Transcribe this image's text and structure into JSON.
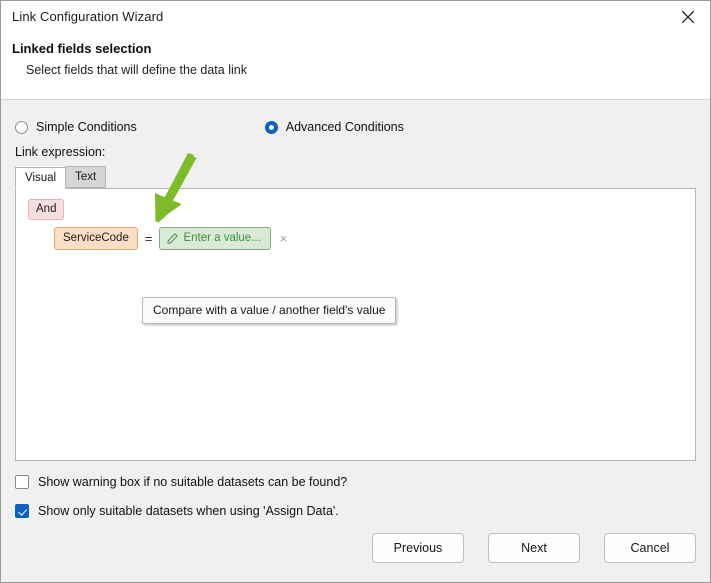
{
  "window": {
    "title": "Link Configuration Wizard",
    "close_icon": "close-icon"
  },
  "header": {
    "title": "Linked fields selection",
    "subtitle": "Select fields that will define the data link"
  },
  "conditions": {
    "mode_options": [
      {
        "label": "Simple Conditions",
        "selected": false
      },
      {
        "label": "Advanced Conditions",
        "selected": true
      }
    ],
    "simple_label": "Simple Conditions",
    "advanced_label": "Advanced Conditions",
    "expression_label": "Link expression:"
  },
  "tabs": [
    {
      "label": "Visual",
      "active": true
    },
    {
      "label": "Text",
      "active": false
    }
  ],
  "tab_visual_label": "Visual",
  "tab_text_label": "Text",
  "expression": {
    "operator_chip": "And",
    "field_chip": "ServiceCode",
    "comparison_operator": "=",
    "value_placeholder": "Enter a value...",
    "value_icon": "pencil-icon",
    "remove_label": "×"
  },
  "tooltip": {
    "text": "Compare with a value / another field's value"
  },
  "options": [
    {
      "label": "Show warning box if no suitable datasets can be found?",
      "checked": false
    },
    {
      "label": "Show only suitable datasets when using 'Assign Data'.",
      "checked": true
    }
  ],
  "option_warning_label": "Show warning box if no suitable datasets can be found?",
  "option_suitable_label": "Show only suitable datasets when using 'Assign Data'.",
  "footer": {
    "previous_label": "Previous",
    "next_label": "Next",
    "cancel_label": "Cancel"
  },
  "colors": {
    "accent_blue": "#0a62c2",
    "and_chip_bg": "#f7dede",
    "field_chip_bg": "#fbdfc5",
    "value_chip_bg": "#d9ead6",
    "value_chip_text": "#3f9140",
    "annotation_arrow": "#7dbb28",
    "panel_bg": "#f0f0f0"
  }
}
